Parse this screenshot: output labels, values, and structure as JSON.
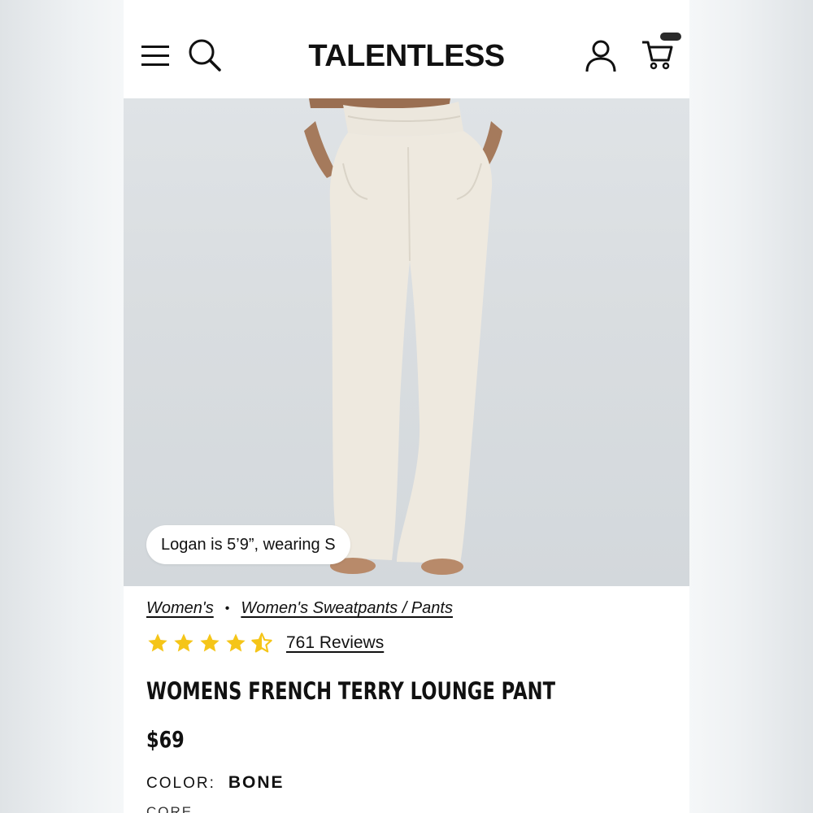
{
  "header": {
    "logo": "TALENTLESS",
    "icons": [
      "menu-icon",
      "search-icon",
      "account-icon",
      "cart-icon"
    ]
  },
  "hero": {
    "model_note": "Logan is 5’9”, wearing S"
  },
  "breadcrumb": {
    "items": [
      "Women's",
      "Women's Sweatpants / Pants"
    ]
  },
  "rating": {
    "stars": 4.5,
    "max_stars": 5,
    "reviews_label": "761 Reviews",
    "star_color": "#f5c518"
  },
  "product": {
    "title": "WOMENS FRENCH TERRY LOUNGE PANT",
    "price": "$69",
    "color_label": "COLOR:",
    "color_value": "BONE",
    "next_label_partial": "CORE"
  }
}
